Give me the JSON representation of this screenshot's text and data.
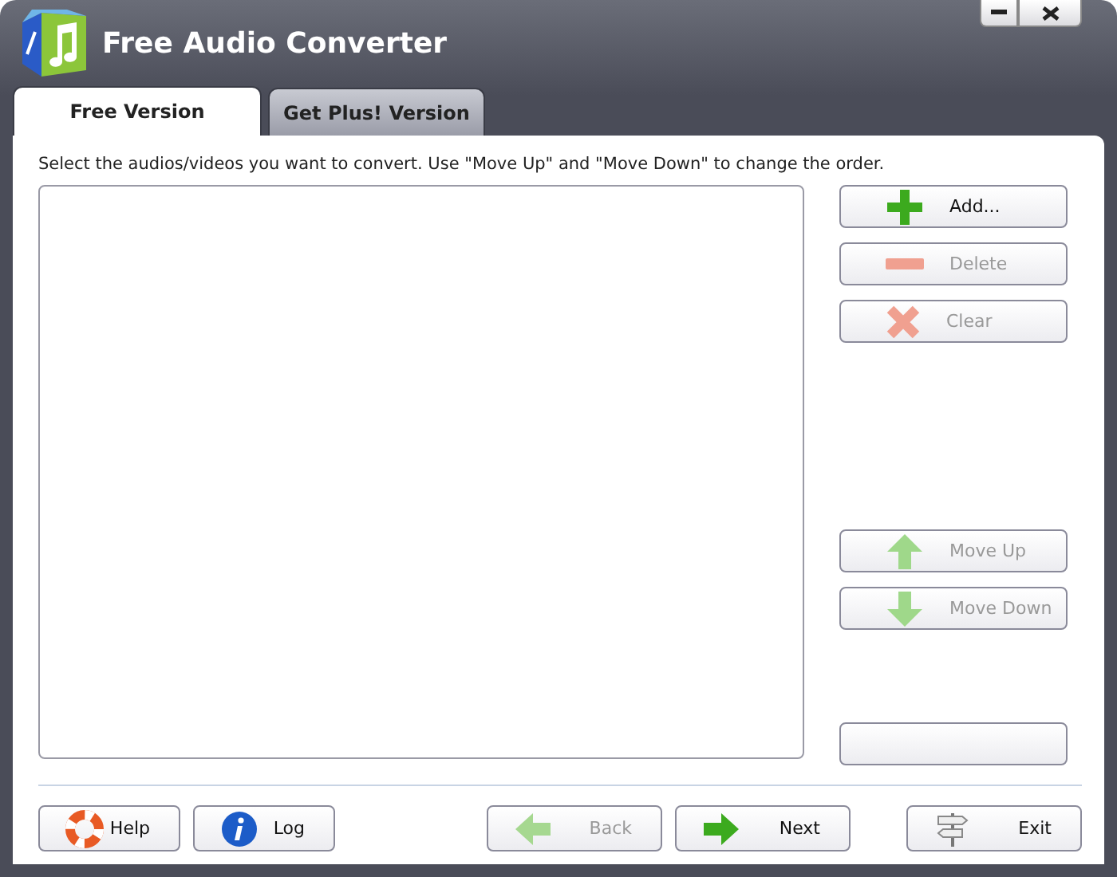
{
  "window": {
    "title": "Free Audio Converter"
  },
  "tabs": [
    {
      "label": "Free Version",
      "selected": true
    },
    {
      "label": "Get Plus! Version",
      "selected": false
    }
  ],
  "instruction": "Select the audios/videos you want to convert. Use \"Move Up\" and \"Move Down\" to change the order.",
  "side_buttons": [
    {
      "kind": "add",
      "label": "Add...",
      "disabled": false
    },
    {
      "kind": "delete",
      "label": "Delete",
      "disabled": true
    },
    {
      "kind": "clear",
      "label": "Clear",
      "disabled": true
    },
    {
      "kind": "up",
      "label": "Move Up",
      "disabled": true
    },
    {
      "kind": "down",
      "label": "Move Down",
      "disabled": true
    },
    {
      "kind": "blank"
    }
  ],
  "bottom_buttons": [
    {
      "kind": "help",
      "label": "Help",
      "disabled": false
    },
    {
      "kind": "log",
      "label": "Log",
      "disabled": false
    },
    {
      "kind": "back",
      "label": "Back",
      "disabled": true
    },
    {
      "kind": "next",
      "label": "Next",
      "disabled": false
    },
    {
      "kind": "exit",
      "label": "Exit",
      "disabled": false
    }
  ]
}
